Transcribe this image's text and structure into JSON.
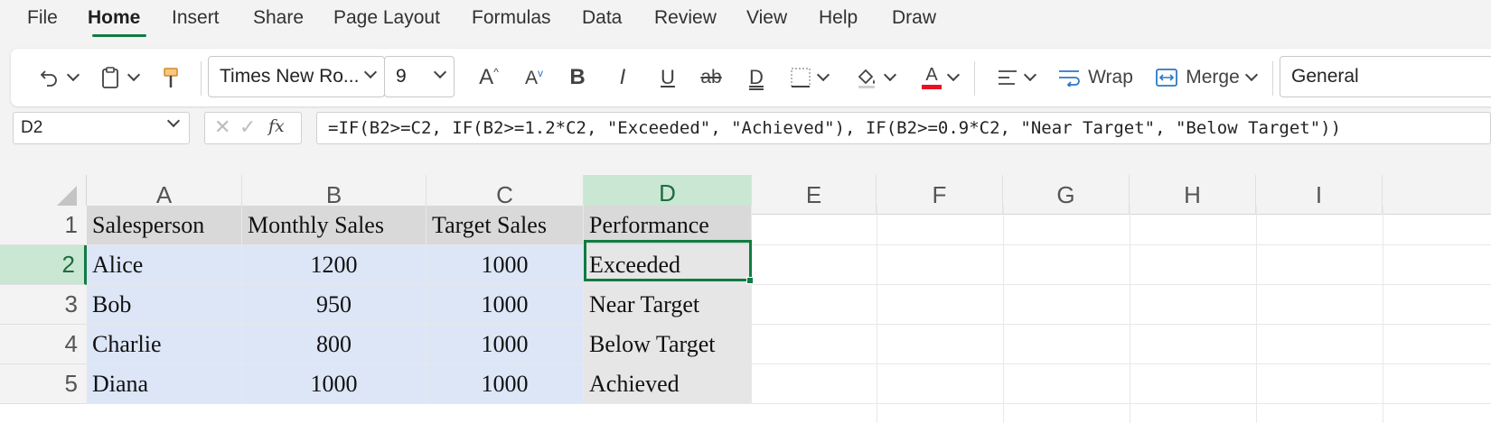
{
  "menu": [
    "File",
    "Home",
    "Insert",
    "Share",
    "Page Layout",
    "Formulas",
    "Data",
    "Review",
    "View",
    "Help",
    "Draw"
  ],
  "ribbon": {
    "font_name": "Times New Ro...",
    "font_size": "9",
    "wrap_label": "Wrap",
    "merge_label": "Merge",
    "number_format": "General",
    "font_color": "#e81123"
  },
  "formula_bar": {
    "name_box": "D2",
    "fx_label": "fx",
    "formula": "=IF(B2>=C2, IF(B2>=1.2*C2, \"Exceeded\", \"Achieved\"), IF(B2>=0.9*C2, \"Near Target\", \"Below Target\"))"
  },
  "columns": [
    "A",
    "B",
    "C",
    "D",
    "E",
    "F",
    "G",
    "H",
    "I"
  ],
  "rows": [
    "1",
    "2",
    "3",
    "4",
    "5"
  ],
  "cells": [
    [
      "Salesperson",
      "Monthly Sales",
      "Target Sales",
      "Performance"
    ],
    [
      "Alice",
      "1200",
      "1000",
      "Exceeded"
    ],
    [
      "Bob",
      "950",
      "1000",
      "Near Target"
    ],
    [
      "Charlie",
      "800",
      "1000",
      "Below Target"
    ],
    [
      "Diana",
      "1000",
      "1000",
      "Achieved"
    ]
  ],
  "colors": {
    "accent": "#107c41",
    "range_fill": "#dce6f7",
    "header_fill": "#d9d9d9",
    "performance_fill": "#e6e6e6"
  }
}
